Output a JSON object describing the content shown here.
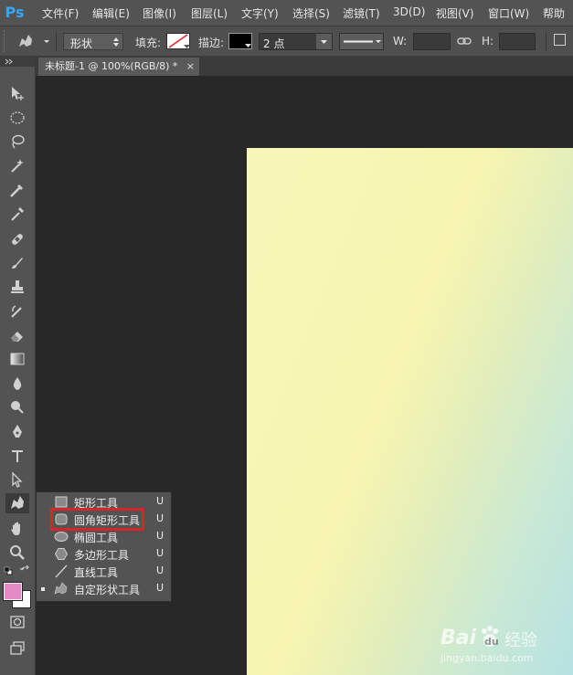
{
  "app": {
    "logo": "Ps"
  },
  "menu": [
    "文件(F)",
    "编辑(E)",
    "图像(I)",
    "图层(L)",
    "文字(Y)",
    "选择(S)",
    "滤镜(T)",
    "3D(D)",
    "视图(V)",
    "窗口(W)",
    "帮助"
  ],
  "options": {
    "mode_value": "形状",
    "fill_label": "填充:",
    "stroke_label": "描边:",
    "stroke_width_value": "2 点",
    "w_label": "W:",
    "h_label": "H:"
  },
  "document_tab": {
    "title": "未标题-1 @ 100%(RGB/8) *",
    "close": "×"
  },
  "flyout": {
    "items": [
      {
        "label": "矩形工具",
        "key": "U",
        "icon": "rectangle-icon",
        "selected": false
      },
      {
        "label": "圆角矩形工具",
        "key": "U",
        "icon": "rounded-rectangle-icon",
        "selected": false
      },
      {
        "label": "椭圆工具",
        "key": "U",
        "icon": "ellipse-icon",
        "selected": false
      },
      {
        "label": "多边形工具",
        "key": "U",
        "icon": "polygon-icon",
        "selected": false
      },
      {
        "label": "直线工具",
        "key": "U",
        "icon": "line-icon",
        "selected": false
      },
      {
        "label": "自定形状工具",
        "key": "U",
        "icon": "custom-shape-icon",
        "selected": true
      }
    ]
  },
  "colors": {
    "foreground": "#e48ac4",
    "background": "#ffffff",
    "highlight": "#d8242a",
    "canvas_start": "#f7f6b7",
    "canvas_end": "#b6e2e2"
  },
  "watermark": {
    "brand": "Bai",
    "paw": "du",
    "cn": "经验",
    "url": "jingyan.baidu.com"
  }
}
